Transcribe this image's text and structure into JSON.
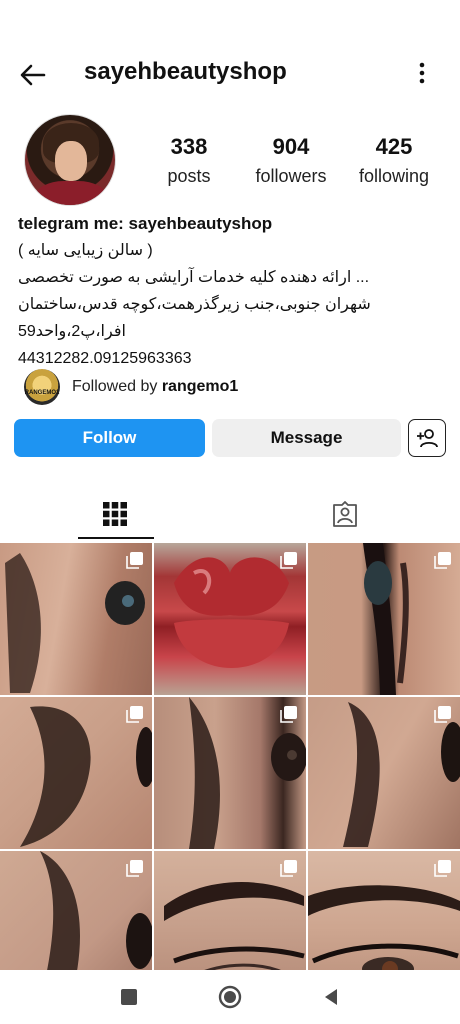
{
  "header": {
    "username": "sayehbeautyshop",
    "back_icon": "arrow-left-icon",
    "menu_icon": "more-vertical-icon"
  },
  "profile": {
    "stats": [
      {
        "value": "338",
        "label": "posts"
      },
      {
        "value": "904",
        "label": "followers"
      },
      {
        "value": "425",
        "label": "following"
      }
    ]
  },
  "bio": {
    "title": "telegram me: sayehbeautyshop",
    "lines": [
      "( سالن زیبایی سایه )",
      "... ارائه دهنده کلیه خدمات آرایشی به صورت تخصصی",
      "شهران جنوبی،جنب زیرگذرهمت،کوچه قدس،ساختمان",
      "افرا،پ2،واحد59",
      "44312282.09125963363"
    ]
  },
  "followed_by": {
    "prefix": "Followed by ",
    "name": "rangemo1",
    "avatar_text": "RANGEMO1"
  },
  "actions": {
    "follow": "Follow",
    "message": "Message",
    "suggest_icon": "person-add-icon"
  },
  "tabs": [
    {
      "icon": "grid-icon",
      "active": true
    },
    {
      "icon": "tagged-person-icon",
      "active": false
    }
  ],
  "posts": [
    {
      "subject": "eye-brow",
      "icon": "multi-photo-icon"
    },
    {
      "subject": "lips",
      "icon": "multi-photo-icon"
    },
    {
      "subject": "eye-liner",
      "icon": "multi-photo-icon"
    },
    {
      "subject": "eyebrow",
      "icon": "multi-photo-icon"
    },
    {
      "subject": "eyebrow",
      "icon": "multi-photo-icon"
    },
    {
      "subject": "eyebrow",
      "icon": "multi-photo-icon"
    },
    {
      "subject": "eyebrow",
      "icon": "multi-photo-icon"
    },
    {
      "subject": "eyebrow",
      "icon": "multi-photo-icon"
    },
    {
      "subject": "eyebrow",
      "icon": "multi-photo-icon"
    }
  ],
  "system_nav": {
    "recents_icon": "square-icon",
    "home_icon": "circle-icon",
    "back_icon": "triangle-back-icon"
  },
  "colors": {
    "follow_button": "#1e94f2",
    "message_button": "#efefef"
  }
}
